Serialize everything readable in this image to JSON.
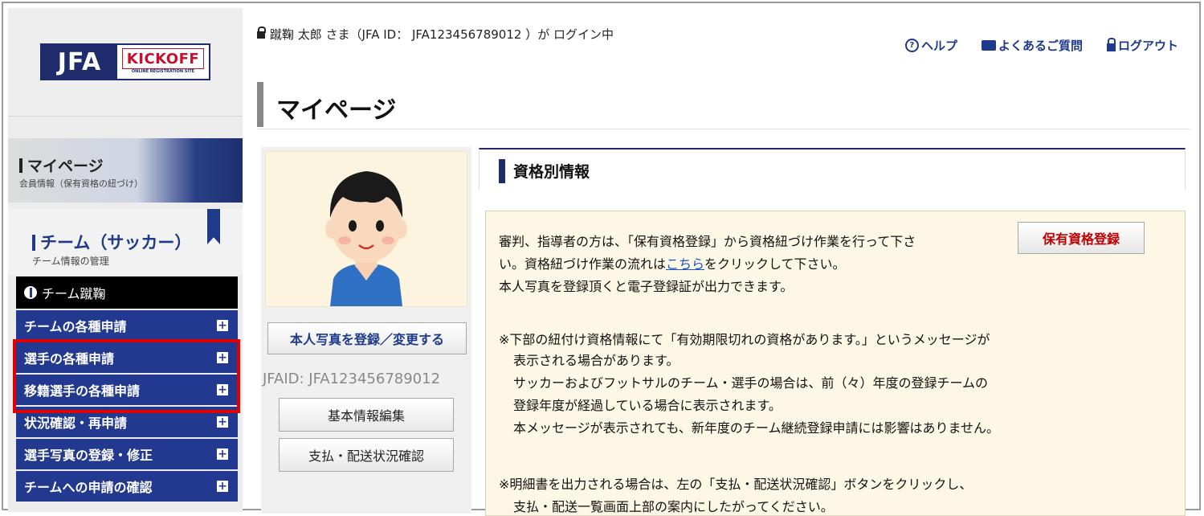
{
  "header": {
    "login_text": "蹴鞠 太郎 さま（JFA ID： JFA123456789012 ）が ログイン中",
    "help": "ヘルプ",
    "faq": "よくあるご質問",
    "logout": "ログアウト"
  },
  "logo": {
    "jfa": "JFA",
    "kickoff": "KICKOFF",
    "sub": "ONLINE REGISTRATION SITE"
  },
  "sidebar": {
    "mypage_title": "マイページ",
    "mypage_sub": "会員情報（保有資格の紐づけ）",
    "team_title": "チーム（サッカー）",
    "team_sub": "チーム情報の管理",
    "menu_head": "チーム蹴鞠",
    "menu_items": [
      {
        "label": "チームの各種申請"
      },
      {
        "label": "選手の各種申請"
      },
      {
        "label": "移籍選手の各種申請"
      },
      {
        "label": "状況確認・再申請"
      },
      {
        "label": "選手写真の登録・修正"
      },
      {
        "label": "チームへの申請の確認"
      }
    ],
    "expand_symbol": "+"
  },
  "page": {
    "title": "マイページ"
  },
  "profile": {
    "photo_button": "本人写真を登録／変更する",
    "jfaid": "JFAID: JFA123456789012",
    "basic_button": "基本情報編集",
    "pay_button": "支払・配送状況確認"
  },
  "qualification": {
    "title": "資格別情報",
    "register_button": "保有資格登録",
    "line1": "審判、指導者の方は、「保有資格登録」から資格紐づけ作業を行って下さ",
    "line2_pre": "い。資格紐づけ作業の流れは",
    "line2_link": "こちら",
    "line2_post": "をクリックして下さい。",
    "line3": "本人写真を登録頂くと電子登録証が出力できます。",
    "note1_l1": "※下部の紐付け資格情報にて「有効期限切れの資格があります。」というメッセージが",
    "note1_l2": "表示される場合があります。",
    "note1_l3": "サッカーおよびフットサルのチーム・選手の場合は、前（々）年度の登録チームの",
    "note1_l4": "登録年度が経過している場合に表示されます。",
    "note1_l5": "本メッセージが表示されても、新年度のチーム継続登録申請には影響はありません。",
    "note2_l1": "※明細書を出力される場合は、左の「支払・配送状況確認」ボタンをクリックし、",
    "note2_l2": "支払・配送一覧画面上部の案内にしたがってください。"
  },
  "colors": {
    "navy": "#1e2c6b",
    "menu_blue": "#23398f",
    "highlight_red": "#e00000",
    "register_red": "#c00000"
  }
}
